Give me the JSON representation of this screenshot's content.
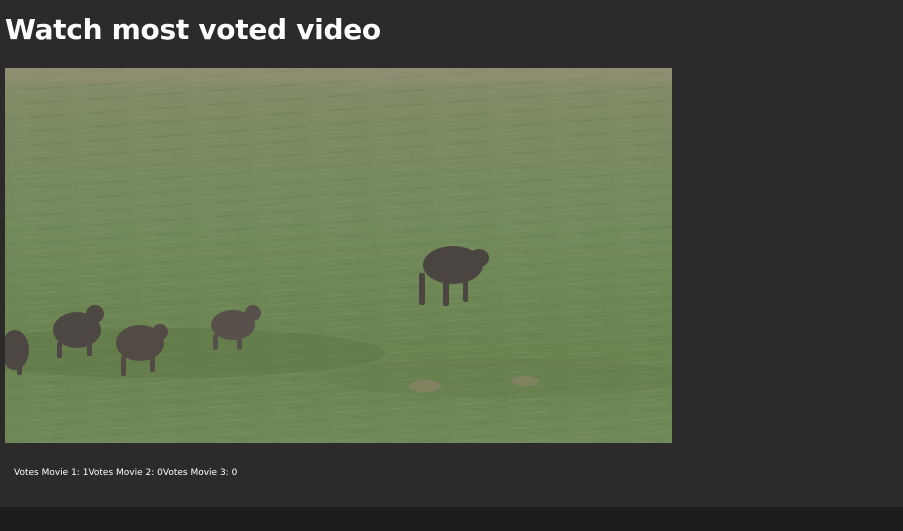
{
  "page": {
    "title": "Watch most voted video"
  },
  "video": {
    "scene": "boar-herd-running-across-grass-field"
  },
  "votes": [
    {
      "label": "Votes Movie 1: ",
      "count": "1"
    },
    {
      "label": "Votes Movie 2: ",
      "count": "0"
    },
    {
      "label": "Votes Movie 3: ",
      "count": "0"
    }
  ],
  "colors": {
    "background": "#2c2a2b",
    "bottom_bar": "#1e1d1d",
    "text": "#ffffff",
    "field_green": "#6e8257",
    "boar": "#4a4340"
  }
}
